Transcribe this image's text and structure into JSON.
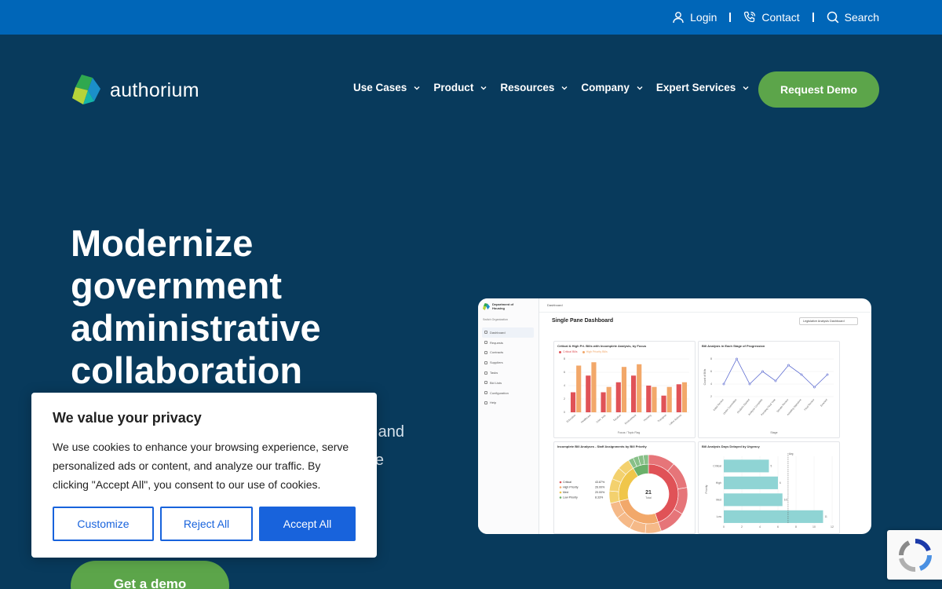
{
  "topbar": {
    "login": "Login",
    "contact": "Contact",
    "search": "Search"
  },
  "logo": {
    "wordmark": "authorium"
  },
  "nav": {
    "items": [
      "Use Cases",
      "Product",
      "Resources",
      "Company",
      "Expert Services"
    ],
    "cta": "Request Demo"
  },
  "hero": {
    "title_lines": [
      "Modernize",
      "government",
      "administrative",
      "collaboration"
    ],
    "subtitle_lines": [
      "and",
      "e"
    ],
    "cta": "Get a demo"
  },
  "dashboard": {
    "org_name": "Department of Housing",
    "switch_org": "Switch Organization",
    "crumb": "Dashboard",
    "title": "Single Pane Dashboard",
    "select_value": "Legislative Analysis Dashboard",
    "sidebar_items": [
      "Dashboard",
      "Requests",
      "Contracts",
      "Suppliers",
      "Tasks",
      "Bid Lists",
      "Configuration",
      "Help"
    ],
    "panels": {
      "bar": {
        "title": "Critical & High Pri. Bills with Incomplete Analysis, by Focus",
        "legend": [
          "Critical Bills",
          "High Priority Bills"
        ],
        "categories": [
          "Education",
          "Healthcare",
          "Crim. Just.",
          "Taxation",
          "Environment",
          "Housing",
          "Transport",
          "Labor Reform"
        ],
        "critical": [
          3,
          5.5,
          3,
          4.5,
          5.5,
          4,
          2.5,
          4.2
        ],
        "high": [
          7,
          7.5,
          3.8,
          6.8,
          7.2,
          3.8,
          3.8,
          4.5
        ],
        "ylim": [
          0,
          8
        ],
        "yticks": [
          "0",
          "2",
          "4",
          "6",
          "8"
        ],
        "xlabel": "Focus / Topic Flag",
        "critical_color": "#e05257",
        "high_color": "#f2a86a"
      },
      "line": {
        "title": "Bill Analysis in Each Stage of Progression",
        "values": [
          4,
          8,
          4,
          6,
          4.5,
          7,
          5.5,
          3.5,
          5.5
        ],
        "ylim": [
          2,
          9
        ],
        "yticks": [
          "2",
          "4",
          "6",
          "8"
        ],
        "ylabel": "Count of Bills",
        "xlabel": "Stage",
        "categories": [
          "Initial Review",
          "Under Committee",
          "Analysis Started",
          "Analysis Complete",
          "Pending Final Vote",
          "Senate Review",
          "Awaiting Signature",
          "Final Review",
          "Enacted"
        ],
        "color": "#5b6ad0"
      },
      "donut": {
        "title": "Incomplete Bill Analyses - Staff Assignments by Bill Priority",
        "center_value": "21",
        "center_label": "Total",
        "legend": [
          {
            "label": "Critical",
            "pct": "43.87%",
            "color": "#e05257"
          },
          {
            "label": "High Priority",
            "pct": "26.00%",
            "color": "#f2a86a"
          },
          {
            "label": "Med",
            "pct": "20.00%",
            "color": "#f0c64a"
          },
          {
            "label": "Low Priority",
            "pct": "8.33%",
            "color": "#6ab06a"
          }
        ],
        "values": [
          43.87,
          26.0,
          20.0,
          8.33
        ]
      },
      "hbar": {
        "title": "Bill Analysis Days Delayed by Urgency",
        "categories": [
          "Critical",
          "High",
          "Med",
          "Low"
        ],
        "values": [
          5,
          6,
          6.5,
          11
        ],
        "ylabel": "Priority",
        "avg_label": "Avg",
        "xlim": [
          0,
          12
        ],
        "xticks": [
          "0",
          "2",
          "4",
          "6",
          "8",
          "10",
          "12"
        ],
        "color": "#8fd4d4"
      }
    }
  },
  "cookie": {
    "title": "We value your privacy",
    "text": "We use cookies to enhance your browsing experience, serve personalized ads or content, and analyze our traffic. By clicking \"Accept All\", you consent to our use of cookies.",
    "customize": "Customize",
    "reject": "Reject All",
    "accept": "Accept All"
  }
}
